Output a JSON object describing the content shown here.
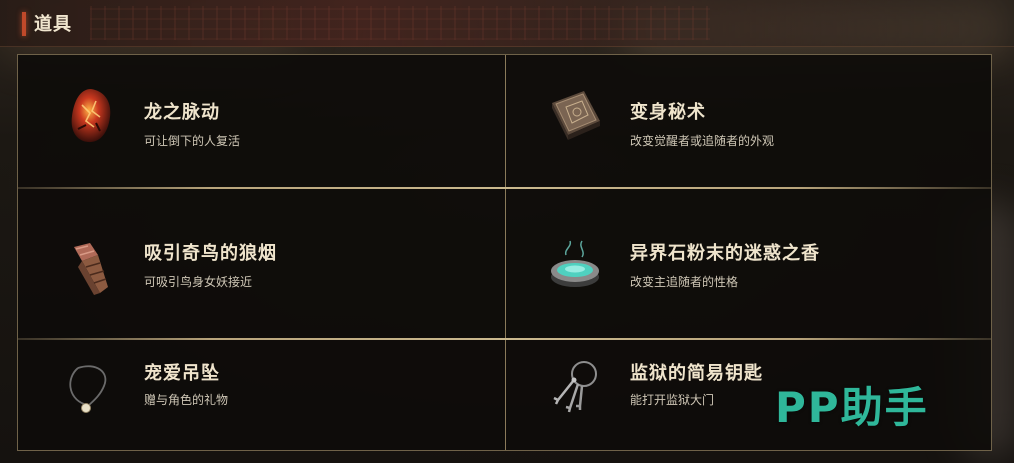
{
  "header": {
    "title": "道具"
  },
  "items": [
    {
      "name": "龙之脉动",
      "desc": "可让倒下的人复活",
      "icon": "dragon-heart-stone-icon"
    },
    {
      "name": "变身秘术",
      "desc": "改变觉醒者或追随者的外观",
      "icon": "spellbook-icon"
    },
    {
      "name": "吸引奇鸟的狼烟",
      "desc": "可吸引鸟身女妖接近",
      "icon": "smoke-bomb-icon"
    },
    {
      "name": "异界石粉末的迷惑之香",
      "desc": "改变主追随者的性格",
      "icon": "incense-bowl-icon"
    },
    {
      "name": "宠爱吊坠",
      "desc": "赠与角色的礼物",
      "icon": "pendant-necklace-icon"
    },
    {
      "name": "监狱的简易钥匙",
      "desc": "能打开监狱大门",
      "icon": "key-ring-icon"
    }
  ],
  "watermark": {
    "text": "PP助手"
  },
  "colors": {
    "accent": "#c0492a",
    "border": "#b9a57c",
    "watermark": "#2fb79a"
  }
}
